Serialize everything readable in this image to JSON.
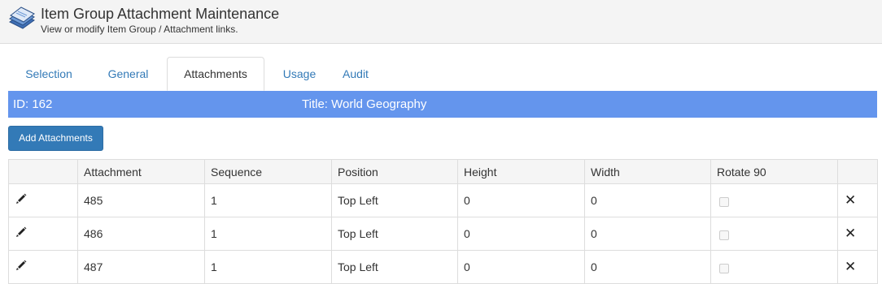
{
  "header": {
    "title": "Item Group Attachment Maintenance",
    "subtitle": "View or modify Item Group / Attachment links."
  },
  "tabs": [
    {
      "label": "Selection",
      "active": false
    },
    {
      "label": "General",
      "active": false
    },
    {
      "label": "Attachments",
      "active": true
    },
    {
      "label": "Usage",
      "active": false
    },
    {
      "label": "Audit",
      "active": false
    }
  ],
  "info_bar": {
    "id_text": "ID: 162",
    "title_text": "Title: World Geography"
  },
  "add_button_label": "Add Attachments",
  "table": {
    "columns": [
      "",
      "Attachment",
      "Sequence",
      "Position",
      "Height",
      "Width",
      "Rotate 90",
      ""
    ],
    "rows": [
      {
        "attachment": "485",
        "sequence": "1",
        "position": "Top Left",
        "height": "0",
        "width": "0",
        "rotate90": false
      },
      {
        "attachment": "486",
        "sequence": "1",
        "position": "Top Left",
        "height": "0",
        "width": "0",
        "rotate90": false
      },
      {
        "attachment": "487",
        "sequence": "1",
        "position": "Top Left",
        "height": "0",
        "width": "0",
        "rotate90": false
      }
    ]
  },
  "icons": {
    "logo": "document-stack-icon",
    "edit": "pencil-icon",
    "delete": "close-icon"
  },
  "colors": {
    "accent": "#337ab7",
    "info_bar": "#6495ed",
    "header_bg": "#f4f4f4"
  }
}
